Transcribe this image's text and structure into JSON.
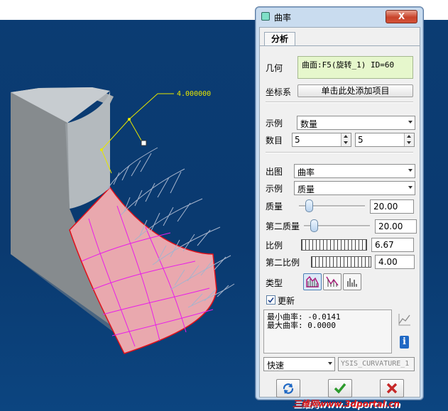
{
  "dialog": {
    "title": "曲率",
    "close_label": "X",
    "tab": "分析",
    "geometry": {
      "label": "几何",
      "value": "曲面:F5(旋转_1) ID=60"
    },
    "csys": {
      "label": "坐标系",
      "button": "单击此处添加项目"
    },
    "sample": {
      "label": "示例",
      "value": "数量"
    },
    "number": {
      "label": "数目",
      "value1": "5",
      "value2": "5"
    },
    "output": {
      "label": "出图",
      "value": "曲率"
    },
    "sample2": {
      "label": "示例",
      "value": "质量"
    },
    "quality": {
      "label": "质量",
      "value": "20.00",
      "slider_fraction": 0.1
    },
    "quality2": {
      "label": "第二质量",
      "value": "20.00",
      "slider_fraction": 0.1
    },
    "scale": {
      "label": "比例",
      "value": "6.67"
    },
    "scale2": {
      "label": "第二比例",
      "value": "4.00"
    },
    "type": {
      "label": "类型"
    },
    "update": {
      "label": "更新",
      "checked": true
    },
    "results": {
      "min": "最小曲率: -0.0141",
      "max": "最大曲率: 0.0000"
    },
    "mode": {
      "value": "快速"
    },
    "name_field": {
      "value": "YSIS_CURVATURE_1"
    }
  },
  "viewport": {
    "dimension": "4.000000"
  },
  "watermark": "三维网www.3dportal.cn",
  "colors": {
    "surface_fill": "#e9a8ae",
    "dialog_bg": "#c9dcef",
    "confirm_green": "#2c9a2c",
    "cancel_red": "#c62828",
    "accent_blue": "#1f68c4"
  },
  "icons": [
    "repeat-icon",
    "check-icon",
    "x-icon",
    "info-icon",
    "graph-icon"
  ]
}
